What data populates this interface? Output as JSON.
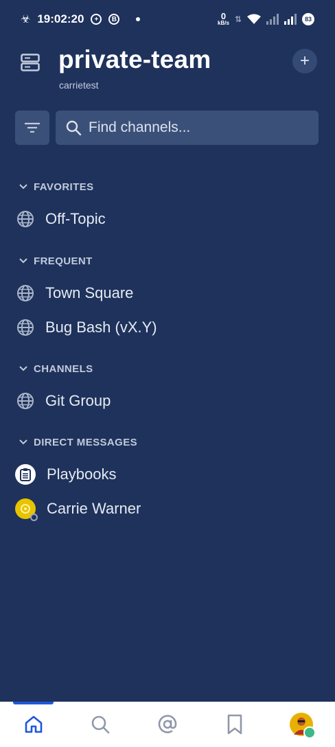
{
  "status_bar": {
    "time": "19:02:20",
    "b_badge": "B",
    "net_speed_value": "0",
    "net_speed_unit": "kB/s",
    "battery": "83"
  },
  "header": {
    "team_name": "private-team",
    "team_subtitle": "carrietest",
    "add_label": "+"
  },
  "search": {
    "placeholder": "Find channels..."
  },
  "sections": {
    "favorites": {
      "title": "FAVORITES",
      "items": [
        "Off-Topic"
      ]
    },
    "frequent": {
      "title": "FREQUENT",
      "items": [
        "Town Square",
        "Bug Bash (vX.Y)"
      ]
    },
    "channels": {
      "title": "CHANNELS",
      "items": [
        "Git Group"
      ]
    },
    "direct_messages": {
      "title": "DIRECT MESSAGES",
      "items": [
        "Playbooks",
        "Carrie Warner"
      ]
    }
  },
  "colors": {
    "sidebar_bg": "#1e325c",
    "input_bg": "#3b5079",
    "accent": "#1c58d9",
    "online": "#3db887",
    "avatar_yellow": "#e8b100"
  },
  "bottom_nav": {
    "icons": [
      "home-icon",
      "search-icon",
      "at-mention-icon",
      "bookmark-icon",
      "profile-avatar"
    ]
  }
}
